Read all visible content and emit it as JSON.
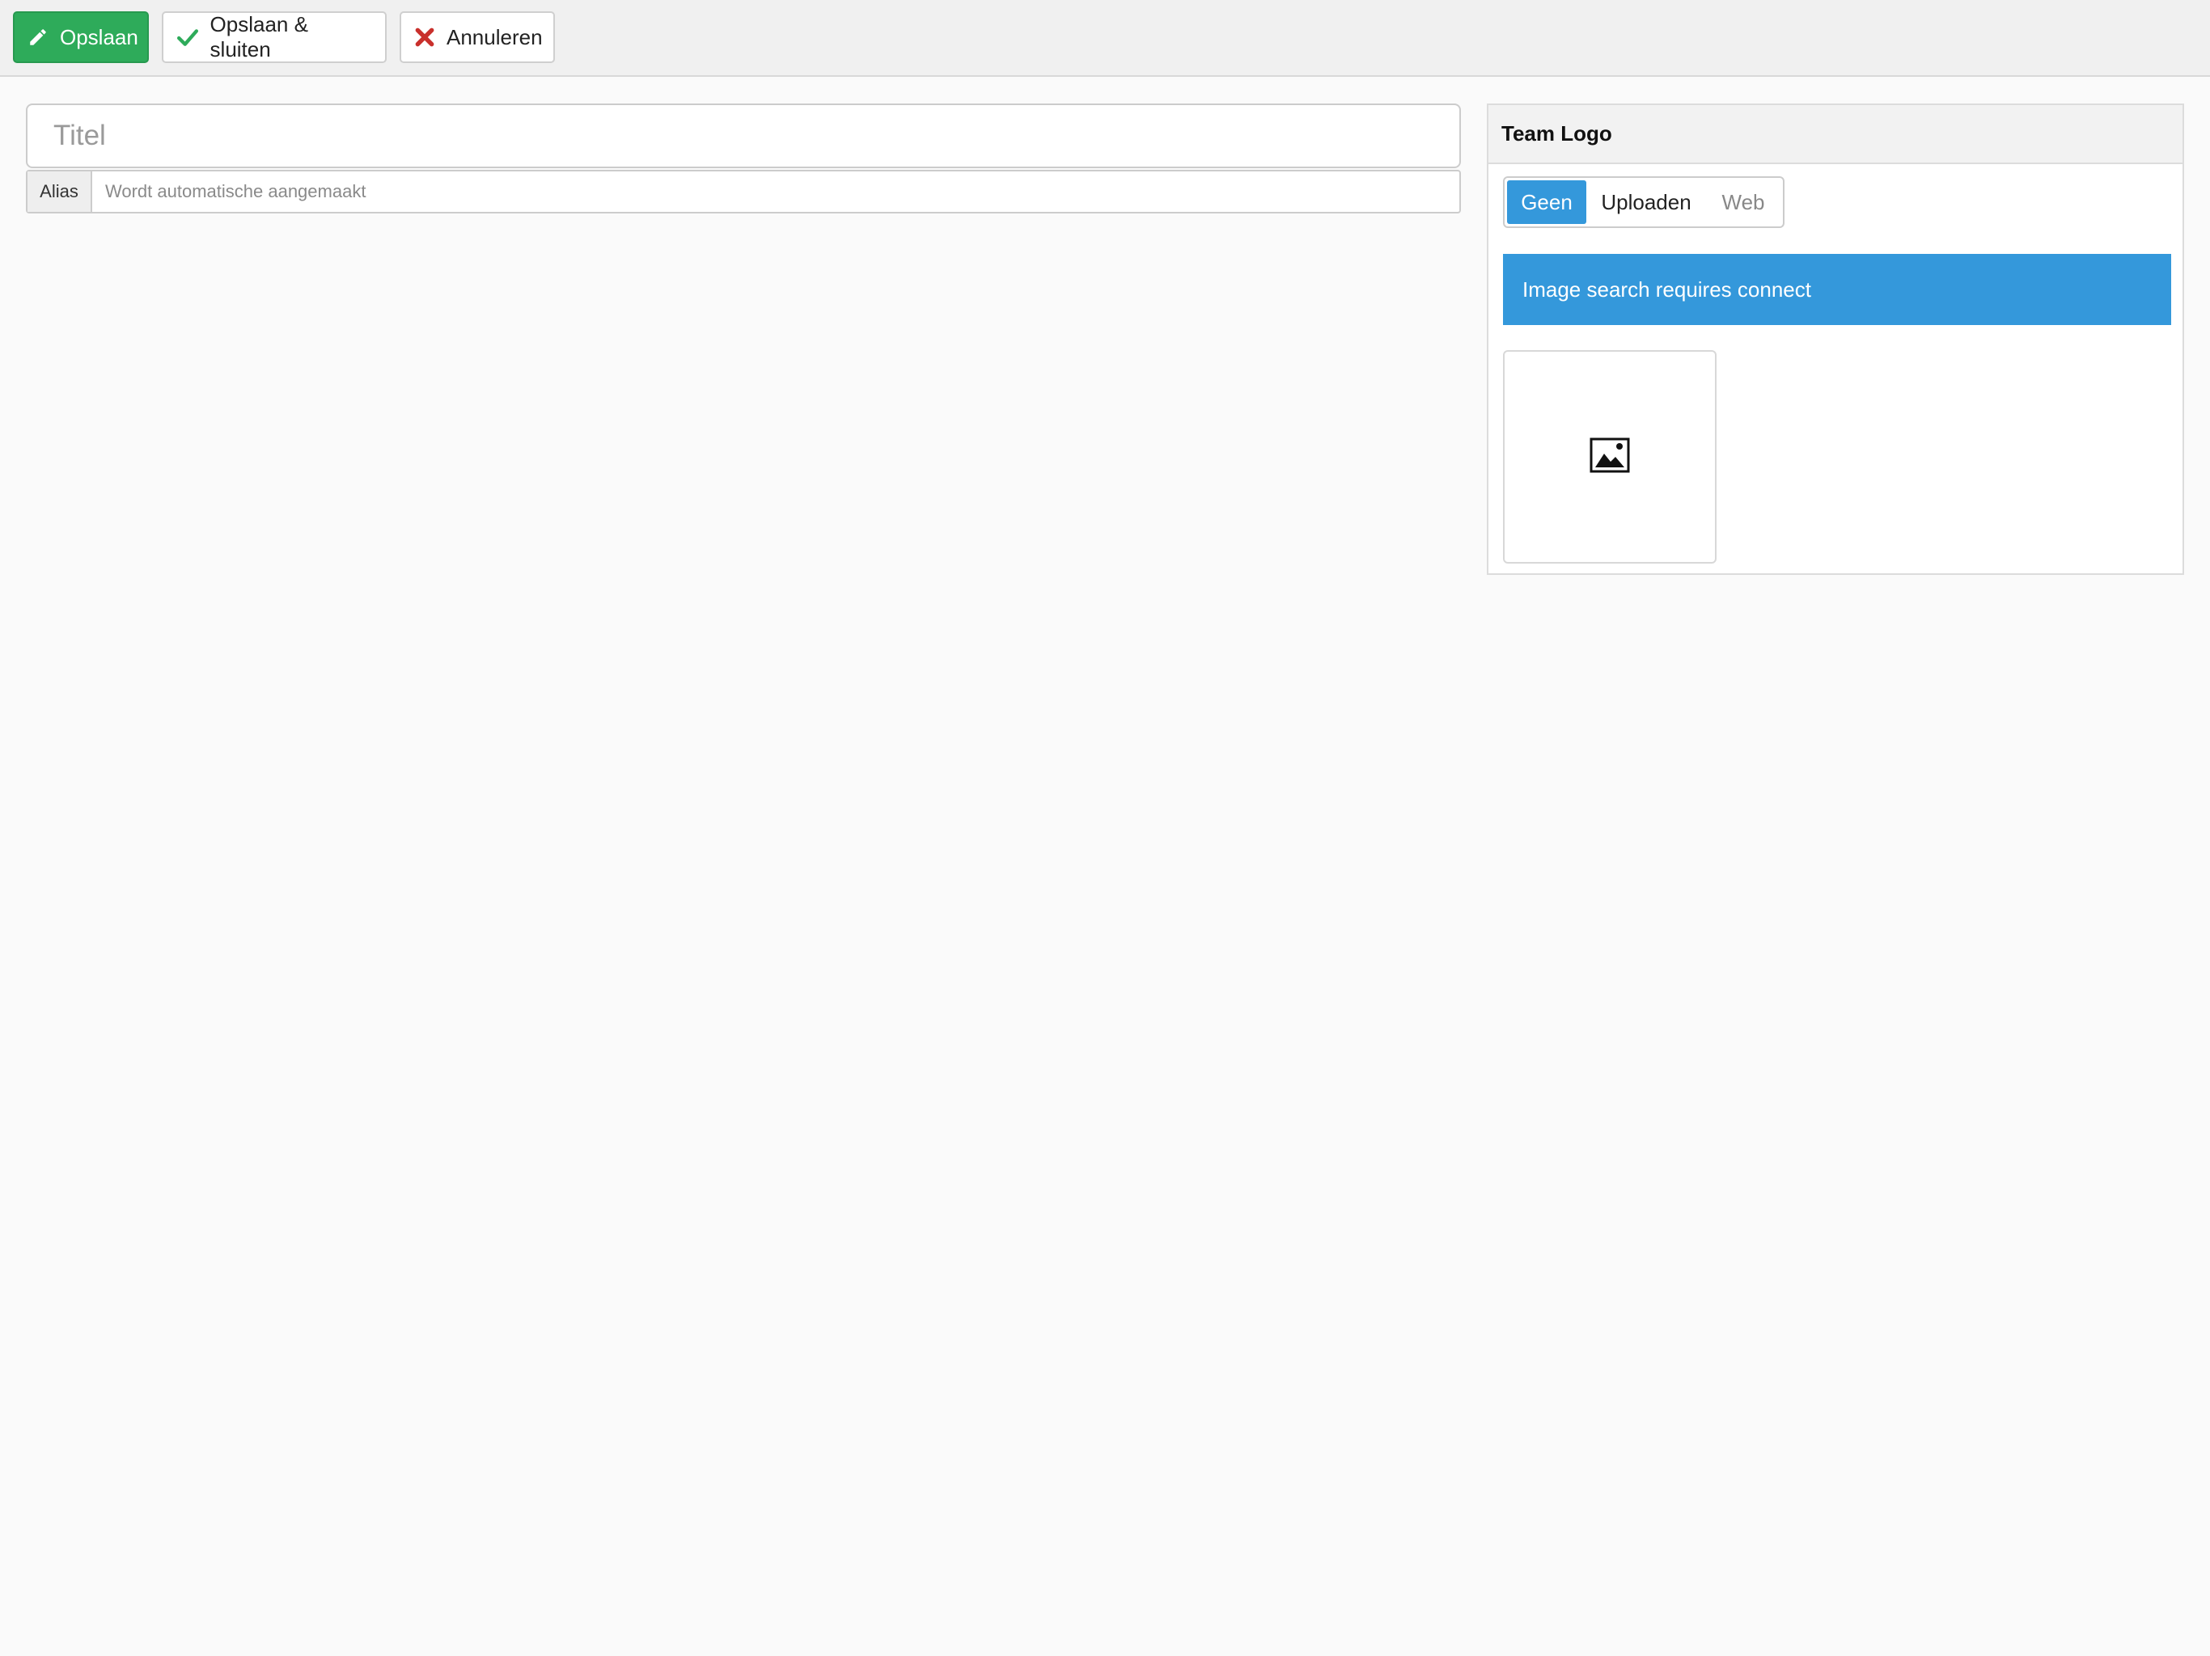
{
  "toolbar": {
    "save_label": "Opslaan",
    "save_close_label": "Opslaan & sluiten",
    "cancel_label": "Annuleren"
  },
  "form": {
    "title_placeholder": "Titel",
    "alias_label": "Alias",
    "alias_placeholder": "Wordt automatische aangemaakt"
  },
  "team_logo": {
    "header": "Team Logo",
    "options": [
      "Geen",
      "Uploaden",
      "Web"
    ],
    "selected": "Geen",
    "info": "Image search requires connect"
  },
  "colors": {
    "save_green": "#2eab5a",
    "accent_blue": "#3498db",
    "cancel_red": "#c9302c"
  },
  "icons": {
    "save": "pencil-icon",
    "save_close": "check-icon",
    "cancel": "x-icon",
    "placeholder": "image-icon"
  }
}
